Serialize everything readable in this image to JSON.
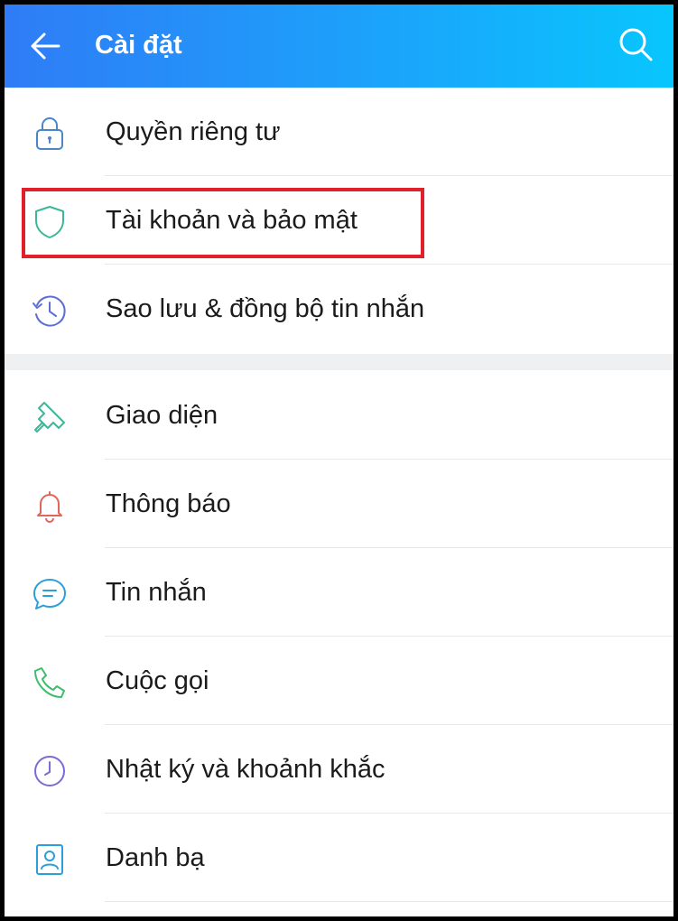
{
  "header": {
    "title": "Cài đặt",
    "back_icon": "arrow-left-icon",
    "search_icon": "search-icon"
  },
  "menu": {
    "group1": [
      {
        "label": "Quyền riêng tư",
        "icon": "lock-icon",
        "color": "#4a86c8"
      },
      {
        "label": "Tài khoản và bảo mật",
        "icon": "shield-icon",
        "color": "#3bb89a"
      },
      {
        "label": "Sao lưu & đồng bộ tin nhắn",
        "icon": "clock-restore-icon",
        "color": "#5b6fd6"
      }
    ],
    "group2": [
      {
        "label": "Giao diện",
        "icon": "paint-brush-icon",
        "color": "#3bb89a"
      },
      {
        "label": "Thông báo",
        "icon": "bell-icon",
        "color": "#e0655a"
      },
      {
        "label": "Tin nhắn",
        "icon": "chat-bubble-icon",
        "color": "#2c9fd9"
      },
      {
        "label": "Cuộc gọi",
        "icon": "phone-icon",
        "color": "#3ebd6b"
      },
      {
        "label": "Nhật ký và khoảnh khắc",
        "icon": "clock-icon",
        "color": "#7a6bd6"
      },
      {
        "label": "Danh bạ",
        "icon": "contact-card-icon",
        "color": "#2c9fd9"
      }
    ]
  },
  "highlight_color": "#e0212b"
}
